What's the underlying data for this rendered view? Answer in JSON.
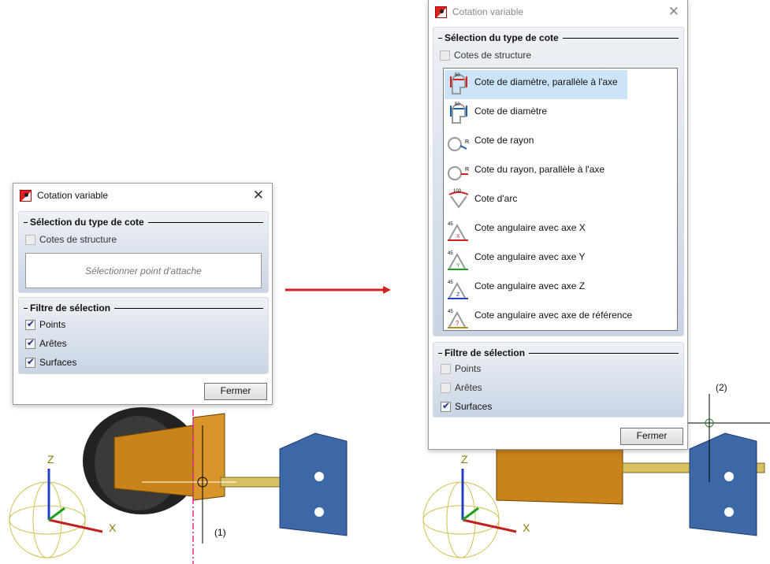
{
  "left_dialog": {
    "title": "Cotation variable",
    "group1": "Sélection du type de cote",
    "structure": "Cotes de structure",
    "prompt": "Sélectionner point d'attache",
    "group2": "Filtre de sélection",
    "filters": [
      {
        "label": "Points",
        "checked": true
      },
      {
        "label": "Arêtes",
        "checked": true
      },
      {
        "label": "Surfaces",
        "checked": true
      }
    ],
    "close": "Fermer"
  },
  "right_dialog": {
    "title": "Cotation variable",
    "group1": "Sélection du type de cote",
    "structure": "Cotes de structure",
    "items": [
      "Cote de diamètre, parallèle à l'axe",
      "Cote de diamètre",
      "Cote de rayon",
      "Cote du rayon, parallèle à l'axe",
      "Cote d'arc",
      "Cote angulaire avec axe X",
      "Cote angulaire avec axe Y",
      "Cote angulaire avec axe Z",
      "Cote angulaire avec axe de référence"
    ],
    "selected_index": 0,
    "group2": "Filtre de sélection",
    "filters": [
      {
        "label": "Points",
        "checked": false
      },
      {
        "label": "Arêtes",
        "checked": false
      },
      {
        "label": "Surfaces",
        "checked": true
      }
    ],
    "close": "Fermer"
  },
  "scene": {
    "label1": "(1)",
    "label2": "(2)",
    "axis_z": "Z",
    "axis_x": "X"
  },
  "colors": {
    "accent_red": "#d42020",
    "selection": "#cce4f7",
    "part_orange": "#c8841a",
    "part_blue": "#3d68a8"
  }
}
